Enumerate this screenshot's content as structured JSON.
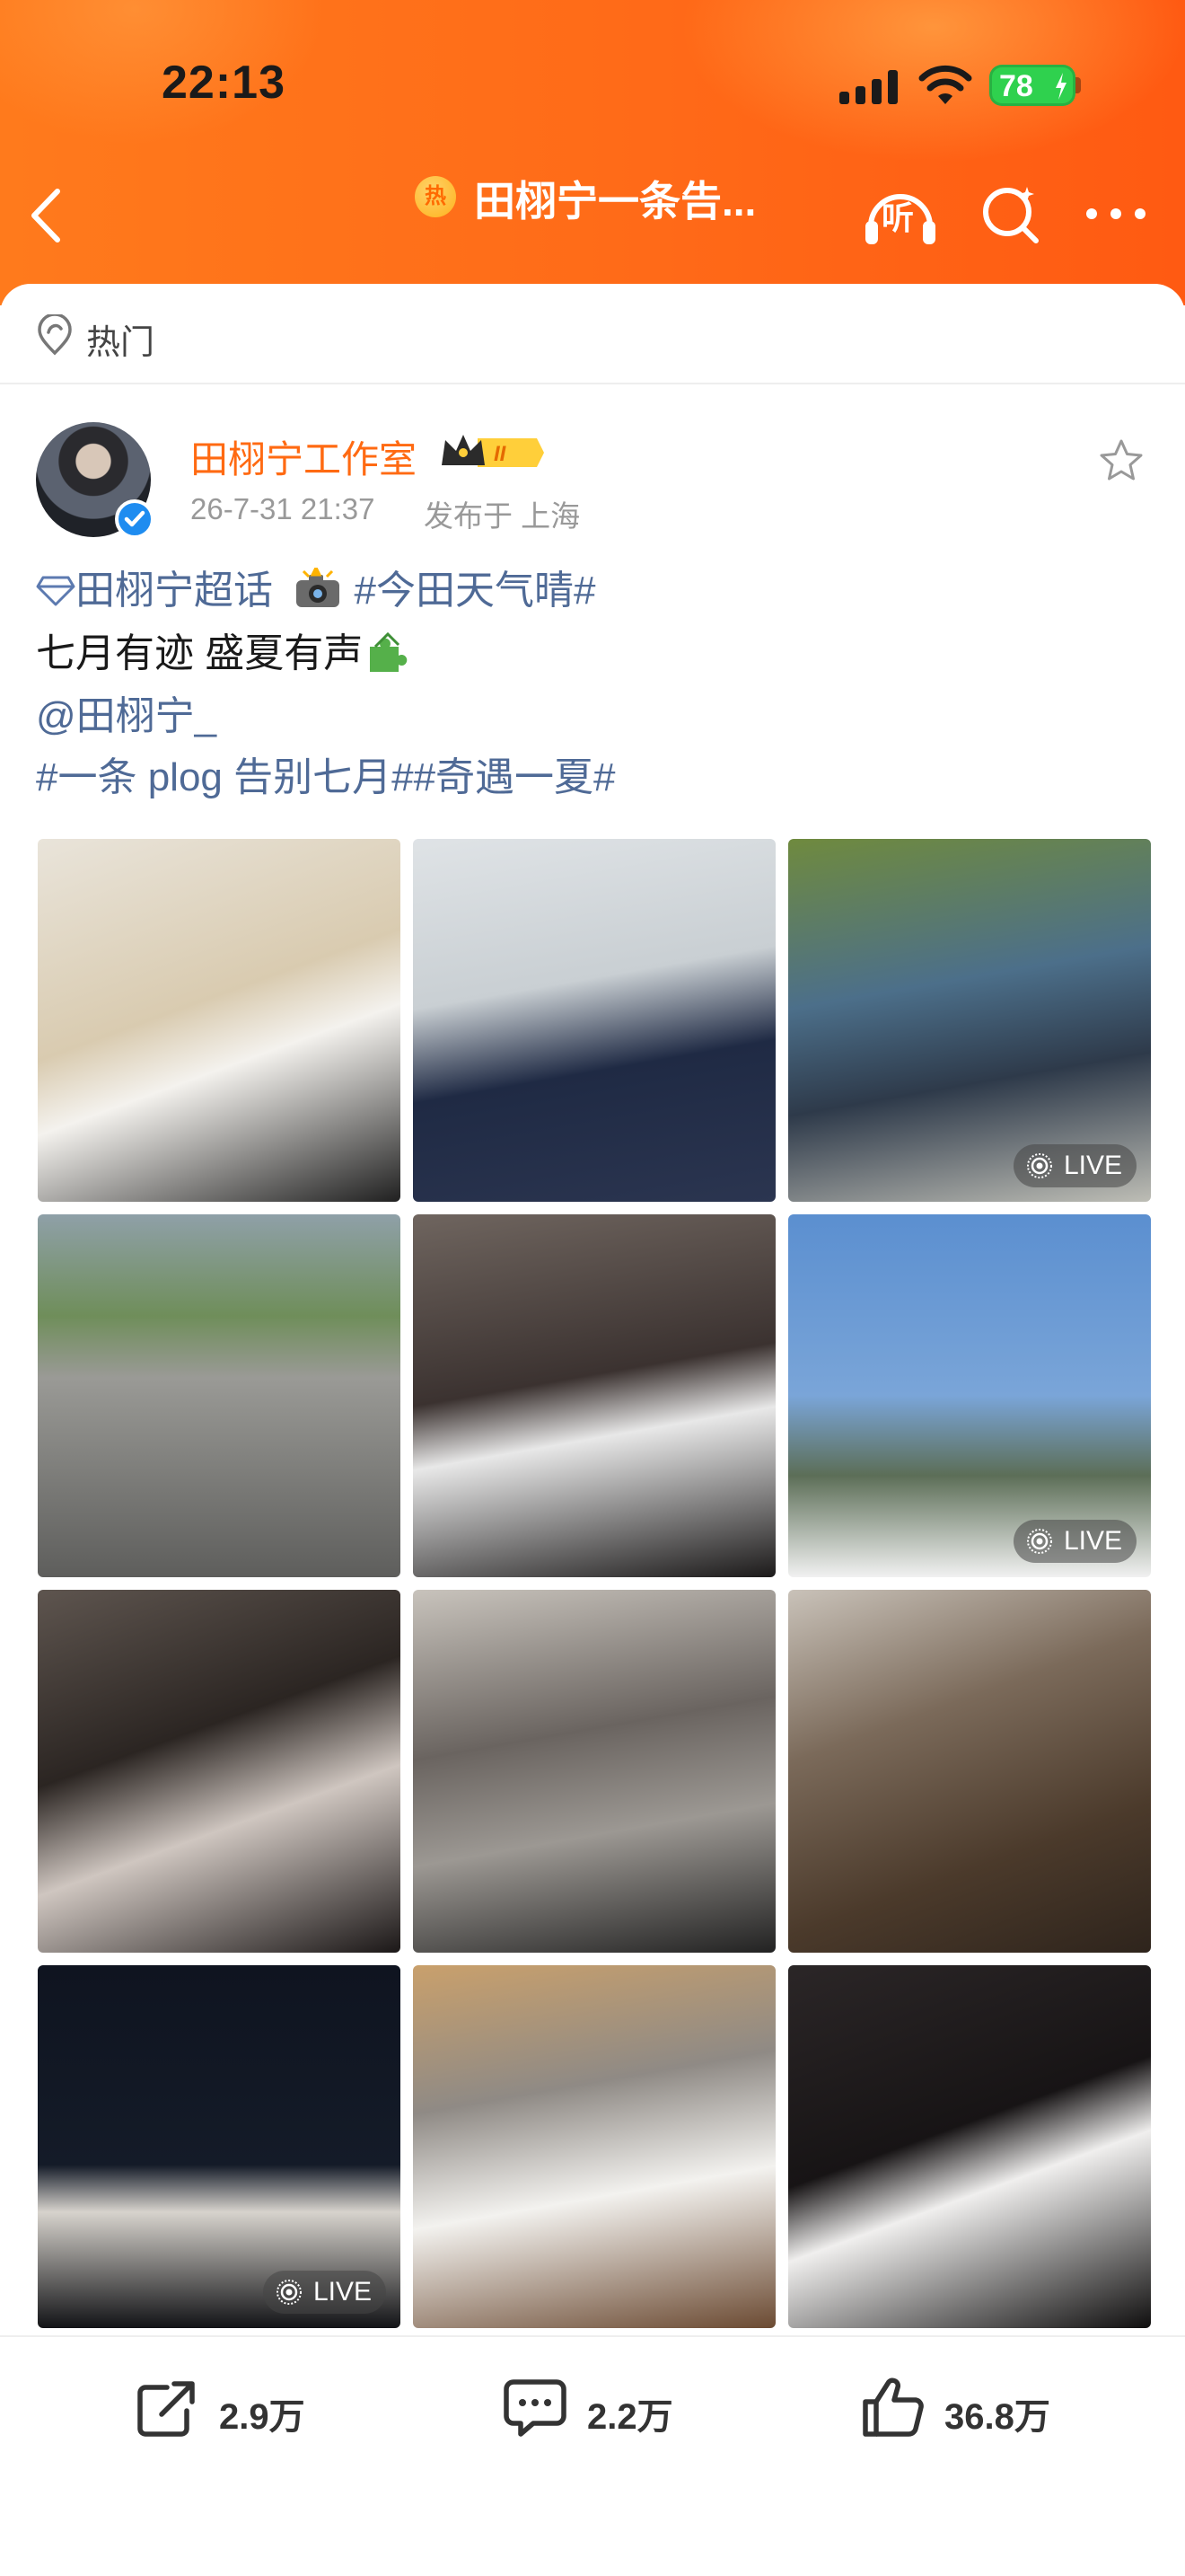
{
  "status_bar": {
    "time": "22:13",
    "battery": "78"
  },
  "nav": {
    "hot_badge": "热",
    "title": "田栩宁一条告...",
    "listen_label": "听",
    "icons": [
      "back-icon",
      "listen-icon",
      "search-icon",
      "more-icon"
    ]
  },
  "section": {
    "label": "热门",
    "icon": "hot-pin-icon"
  },
  "post": {
    "author": "田栩宁工作室",
    "badge": "II",
    "time": "26-7-31 21:37",
    "location": "发布于 上海",
    "lines": {
      "super_topic": "田栩宁超话",
      "topic1": "#今田天气晴#",
      "line2": "七月有迹 盛夏有声",
      "mention": "@田栩宁_",
      "topic2": "#一条 plog 告别七月#",
      "topic3": "#奇遇一夏#"
    }
  },
  "photos": {
    "live_label": "LIVE",
    "items": [
      {
        "live": false,
        "bg": "linear-gradient(160deg,#e9e4da 0%,#d9cbb0 45%,#f4f2ee 60%,#202020 100%)"
      },
      {
        "live": false,
        "bg": "linear-gradient(170deg,#dfe3e6 0%,#c9cfd3 40%,#1f2a44 62%,#2b3550 100%)"
      },
      {
        "live": true,
        "bg": "linear-gradient(170deg,#6f8a3e 0%,#4c6f8a 40%,#2e3a4a 65%,#bdbdb5 100%)"
      },
      {
        "live": false,
        "bg": "linear-gradient(180deg,#8fa0a8 0%,#6f8e5a 28%,#9a9a96 45%,#5e5e5c 100%)"
      },
      {
        "live": false,
        "bg": "linear-gradient(170deg,#6f655f 0%,#3b3230 45%,#e8e8e8 60%,#1c1a1a 100%)"
      },
      {
        "live": true,
        "bg": "linear-gradient(180deg,#5b8fd0 0%,#7aa5d8 50%,#5c6e57 72%,#f1f1f1 100%)"
      },
      {
        "live": false,
        "bg": "linear-gradient(160deg,#5e554f 0%,#2b2522 40%,#cfc6c0 62%,#1b1717 100%)"
      },
      {
        "live": false,
        "bg": "linear-gradient(170deg,#c8c3bc 0%,#6a6460 40%,#9c9893 65%,#222222 100%)"
      },
      {
        "live": false,
        "bg": "linear-gradient(160deg,#c9c2b9 0%,#7b6a5a 35%,#4b3a2b 70%,#2e241c 100%)"
      },
      {
        "live": true,
        "bg": "linear-gradient(180deg,#0f1420 0%,#141b28 55%,#d7d3cd 68%,#121316 100%)"
      },
      {
        "live": false,
        "bg": "linear-gradient(170deg,#c9a06c 0%,#8f8a85 35%,#f3f2ef 62%,#6b4a32 100%)"
      },
      {
        "live": false,
        "bg": "linear-gradient(160deg,#2b2627 0%,#171415 45%,#f0efee 60%,#0f0e0e 100%)"
      }
    ]
  },
  "actions": {
    "share": {
      "icon": "share-icon",
      "count": "2.9万"
    },
    "comment": {
      "icon": "comment-icon",
      "count": "2.2万"
    },
    "like": {
      "icon": "like-icon",
      "count": "36.8万"
    }
  },
  "colors": {
    "brand_orange": "#ff6a12",
    "link_blue": "#4f6a96",
    "verified_blue": "#1e8cf0"
  }
}
